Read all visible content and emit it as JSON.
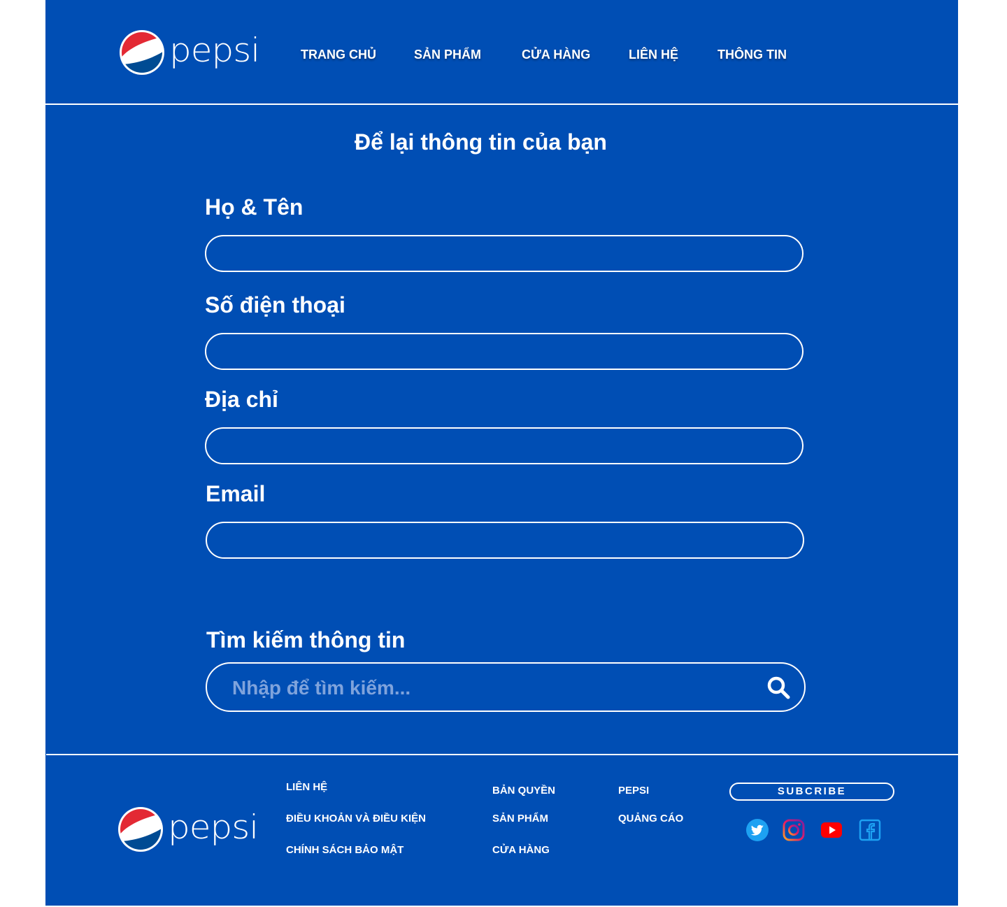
{
  "brand": {
    "wordmark": "pepsi"
  },
  "colors": {
    "background": "#004eb4",
    "pepsi_red": "#e32934",
    "pepsi_blue": "#004b93",
    "placeholder": "#7fa3dc",
    "twitter": "#1da1f2",
    "youtube": "#ff0000",
    "facebook": "#1da1f2"
  },
  "nav": {
    "items": [
      "TRANG CHỦ",
      "SẢN PHẨM",
      "CỬA HÀNG",
      "LIÊN HỆ",
      "THÔNG TIN"
    ]
  },
  "form": {
    "title": "Để lại thông tin của bạn",
    "fields": [
      {
        "label": "Họ & Tên",
        "value": ""
      },
      {
        "label": "Số điện thoại",
        "value": ""
      },
      {
        "label": "Địa chỉ",
        "value": ""
      },
      {
        "label": "Email",
        "value": ""
      }
    ]
  },
  "search": {
    "label": "Tìm kiếm thông tin",
    "placeholder": "Nhập để tìm kiếm...",
    "icon": "search-icon"
  },
  "footer": {
    "col1": [
      "LIÊN HỆ",
      "ĐIỀU KHOẢN VÀ ĐIỀU KIỆN",
      "CHÍNH SÁCH BẢO MẬT"
    ],
    "col2": [
      "BẢN QUYỀN",
      "SẢN PHẨM",
      "CỬA HÀNG"
    ],
    "col3": [
      "PEPSI",
      "QUẢNG CÁO"
    ],
    "subscribe_label": "SUBCRIBE",
    "social": [
      "twitter-icon",
      "instagram-icon",
      "youtube-icon",
      "facebook-icon"
    ]
  }
}
